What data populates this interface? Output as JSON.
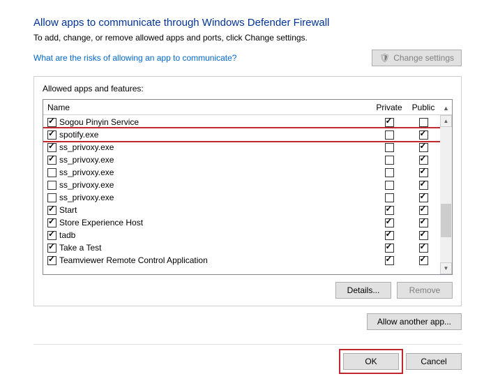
{
  "title": "Allow apps to communicate through Windows Defender Firewall",
  "subtitle": "To add, change, or remove allowed apps and ports, click Change settings.",
  "risks_link": "What are the risks of allowing an app to communicate?",
  "change_settings_label": "Change settings",
  "group_label": "Allowed apps and features:",
  "columns": {
    "name": "Name",
    "private": "Private",
    "public": "Public"
  },
  "rows": [
    {
      "name": "Sogou Pinyin Service",
      "checked": true,
      "private": true,
      "public": false
    },
    {
      "name": "spotify.exe",
      "checked": true,
      "private": false,
      "public": true
    },
    {
      "name": "ss_privoxy.exe",
      "checked": true,
      "private": false,
      "public": true
    },
    {
      "name": "ss_privoxy.exe",
      "checked": true,
      "private": false,
      "public": true
    },
    {
      "name": "ss_privoxy.exe",
      "checked": false,
      "private": false,
      "public": true
    },
    {
      "name": "ss_privoxy.exe",
      "checked": false,
      "private": false,
      "public": true
    },
    {
      "name": "ss_privoxy.exe",
      "checked": false,
      "private": false,
      "public": true
    },
    {
      "name": "Start",
      "checked": true,
      "private": true,
      "public": true
    },
    {
      "name": "Store Experience Host",
      "checked": true,
      "private": true,
      "public": true
    },
    {
      "name": "tadb",
      "checked": true,
      "private": true,
      "public": true
    },
    {
      "name": "Take a Test",
      "checked": true,
      "private": true,
      "public": true
    },
    {
      "name": "Teamviewer Remote Control Application",
      "checked": true,
      "private": true,
      "public": true
    }
  ],
  "highlight_row_index": 1,
  "details_label": "Details...",
  "remove_label": "Remove",
  "allow_another_label": "Allow another app...",
  "ok_label": "OK",
  "cancel_label": "Cancel"
}
